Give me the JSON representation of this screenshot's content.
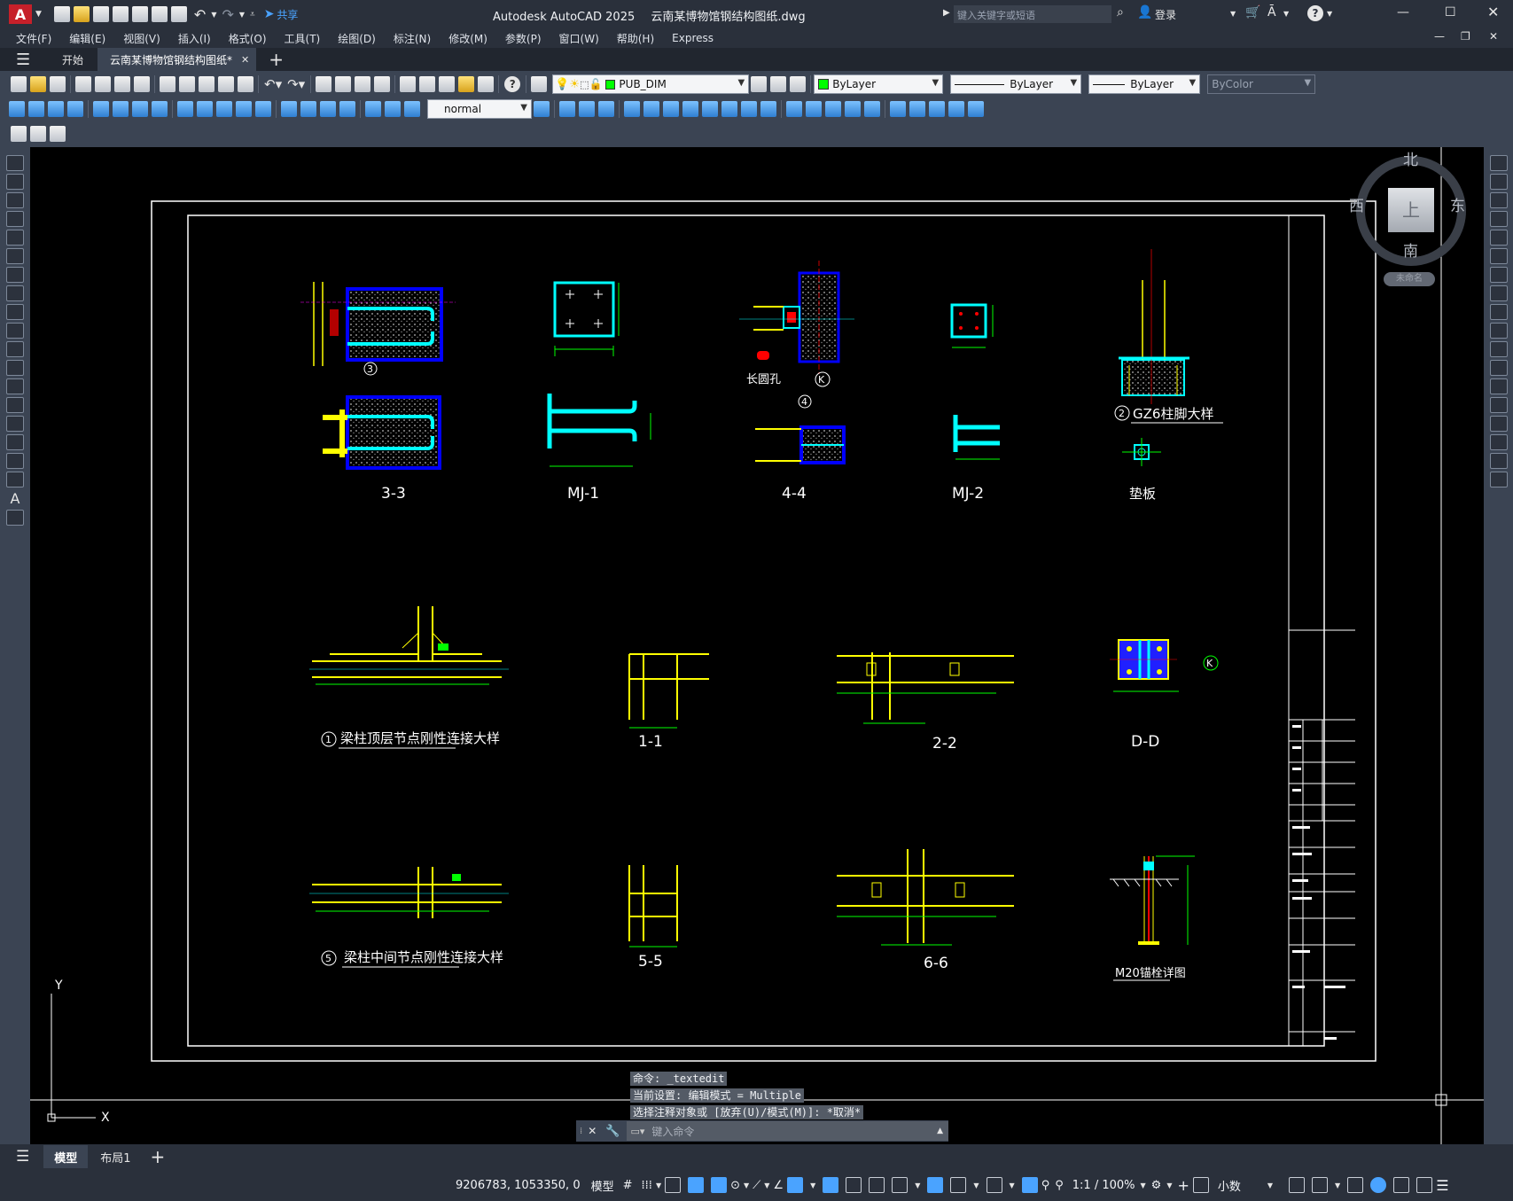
{
  "window": {
    "app_name": "Autodesk AutoCAD 2025",
    "file_name": "云南某博物馆钢结构图纸.dwg",
    "search_placeholder": "键入关键字或短语",
    "login_label": "登录",
    "share_label": "共享",
    "app_letter": "A"
  },
  "menus": [
    "文件(F)",
    "编辑(E)",
    "视图(V)",
    "插入(I)",
    "格式(O)",
    "工具(T)",
    "绘图(D)",
    "标注(N)",
    "修改(M)",
    "参数(P)",
    "窗口(W)",
    "帮助(H)",
    "Express"
  ],
  "tabs": {
    "start": "开始",
    "active": "云南某博物馆钢结构图纸*",
    "add": "+"
  },
  "toolbar": {
    "layer_name": "PUB_DIM",
    "color": "ByLayer",
    "linetype": "ByLayer",
    "lineweight": "ByLayer",
    "plotstyle": "ByColor",
    "dimstyle": "normal"
  },
  "viewcube": {
    "north": "北",
    "south": "南",
    "east": "东",
    "west": "西",
    "face": "上",
    "ucs": "未命名"
  },
  "ucs": {
    "x": "X",
    "y": "Y"
  },
  "drawing": {
    "titles": {
      "s33": "3-3",
      "mj1": "MJ-1",
      "s44": "4-4",
      "mj2": "MJ-2",
      "pad": "垫板",
      "gz6": "GZ6柱脚大样",
      "gz6_no": "2",
      "detail1": "梁柱顶层节点刚性连接大样",
      "detail1_no": "1",
      "s11": "1-1",
      "s22": "2-2",
      "dd": "D-D",
      "detail5": "梁柱中间节点刚性连接大样",
      "detail5_no": "5",
      "s55": "5-5",
      "s66": "6-6",
      "m20": "M20锚栓详图",
      "slot": "长圆孔",
      "bubble3": "3",
      "bubble4": "4",
      "bubbleK": "K"
    }
  },
  "command": {
    "history": [
      "命令: _textedit",
      "当前设置: 编辑模式 = Multiple",
      "选择注释对象或 [放弃(U)/模式(M)]: *取消*"
    ],
    "placeholder": "键入命令"
  },
  "layouts": {
    "model": "模型",
    "layout1": "布局1",
    "add": "+"
  },
  "status": {
    "coords": "9206783, 1053350, 0",
    "space": "模型",
    "scale": "1:1 / 100%",
    "units": "小数"
  },
  "colors": {
    "accent": "#4aa3ff",
    "logo": "#c6202a",
    "canvas": "#000000",
    "cyan": "#00ffff",
    "blue": "#0000ff",
    "yellow": "#ffff00",
    "green": "#00ff00",
    "red": "#ff0000",
    "magenta": "#ff00ff"
  }
}
